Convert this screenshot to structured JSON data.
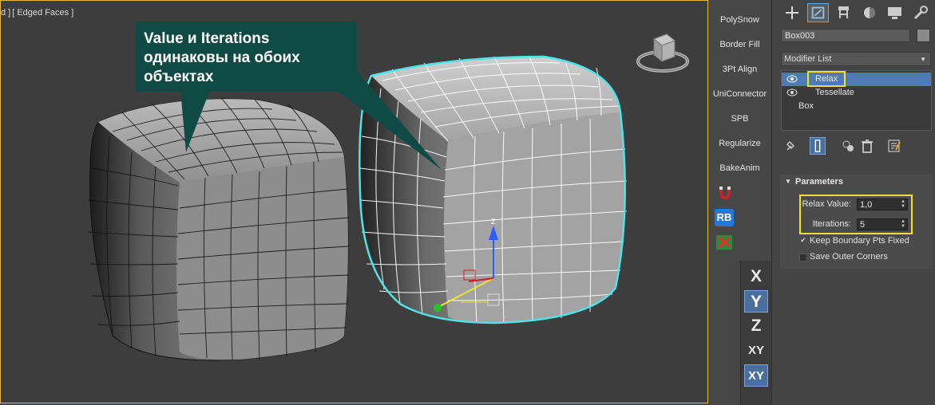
{
  "viewport": {
    "label_prefix": "d ]",
    "label_mode": "[ Edged Faces ]",
    "callout_text": "Value и Iterations\nодинаковы на обоих\nобъектах"
  },
  "toolbar": {
    "buttons": [
      "PolySnow",
      "Border Fill",
      "3Pt Align",
      "UniConnector",
      "SPB",
      "Regularize",
      "BakeAnim"
    ],
    "icons": [
      "magnet-icon",
      "rb-icon",
      "grid-select-icon"
    ],
    "rb_label": "RB"
  },
  "axis": {
    "buttons": [
      {
        "label": "X",
        "active": false
      },
      {
        "label": "Y",
        "active": true
      },
      {
        "label": "Z",
        "active": false
      },
      {
        "label": "XY",
        "active": false
      },
      {
        "label": "XY",
        "active": true
      }
    ]
  },
  "command_panel": {
    "tabs": [
      "create-icon",
      "modify-icon",
      "hierarchy-icon",
      "motion-icon",
      "display-icon",
      "utilities-icon"
    ],
    "active_tab": "modify-icon",
    "object_name": "Box003",
    "modifier_list_label": "Modifier List",
    "stack": [
      {
        "label": "Relax",
        "selected": true,
        "eye": true
      },
      {
        "label": "Tessellate",
        "selected": false,
        "eye": true
      },
      {
        "label": "Box",
        "selected": false,
        "eye": false
      }
    ],
    "parameters": {
      "title": "Parameters",
      "relax_value_label": "Relax Value:",
      "relax_value": "1,0",
      "iterations_label": "Iterations:",
      "iterations": "5",
      "keep_boundary_label": "Keep Boundary Pts Fixed",
      "keep_boundary_checked": "✔",
      "save_outer_label": "Save Outer Corners"
    },
    "colors": {
      "selection": "#4e7bb5",
      "highlight": "#f3e02d",
      "callout": "#0f4a44",
      "wire_select": "#4fe3e8"
    }
  }
}
